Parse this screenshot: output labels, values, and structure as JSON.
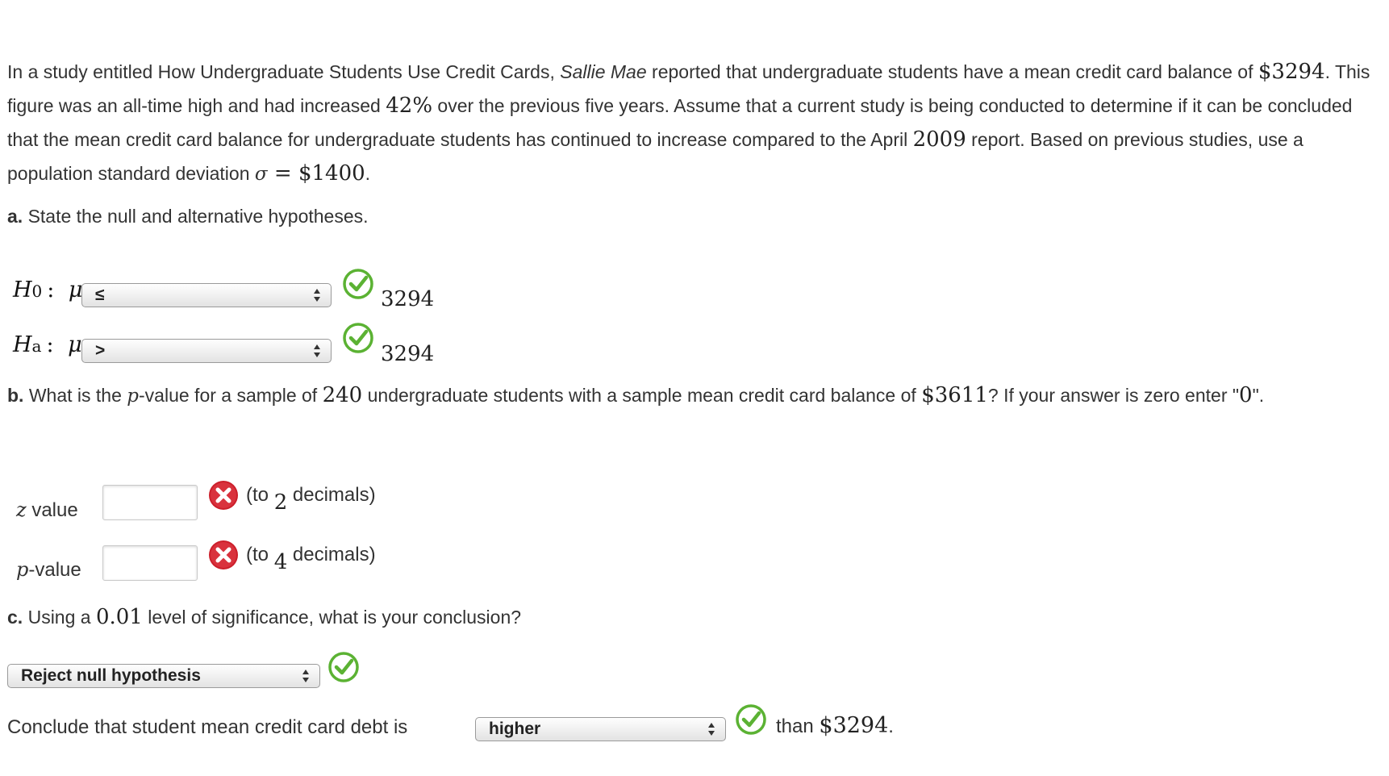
{
  "intro": {
    "t1": "In a study entitled How Undergraduate Students Use Credit Cards, ",
    "brand": "Sallie Mae",
    "t2": " reported that undergraduate students have a mean credit card balance of ",
    "balance": "$3294",
    "t3": ". This figure was an all-time high and had increased ",
    "pct": "42%",
    "t4": " over the previous five years. Assume that a current study is being conducted to determine if it can be concluded that the mean credit card balance for undergraduate students has continued to increase compared to the April ",
    "year": "2009",
    "t5": " report. Based on previous studies, use a population standard deviation ",
    "sigma": "σ",
    "eq": " = ",
    "sigma_val": "$1400",
    "t6": "."
  },
  "part_a": {
    "letter": "a.",
    "text": " State the null and alternative hypotheses.",
    "h0": {
      "H": "H",
      "sub": "0",
      "colon": ":",
      "mu": "μ",
      "selected": "≤",
      "value": "3294"
    },
    "ha": {
      "H": "H",
      "sub": "a",
      "colon": ":",
      "mu": "μ",
      "selected": ">",
      "value": "3294"
    }
  },
  "part_b": {
    "letter": "b.",
    "t1": " What is the ",
    "p": "p",
    "t2": "-value for a sample of ",
    "n": "240",
    "t3": " undergraduate students with a sample mean credit card balance of ",
    "xbar": "$3611",
    "t4": "? If your answer is zero enter \"",
    "zero": "0",
    "t5": "\".",
    "z_label_var": "z",
    "z_label_rest": " value",
    "z_value": "",
    "z_hint_a": "(to ",
    "z_hint_n": "2",
    "z_hint_b": " decimals)",
    "p_label_var": "p",
    "p_label_rest": "-value",
    "p_value": "",
    "p_hint_a": "(to ",
    "p_hint_n": "4",
    "p_hint_b": " decimals)"
  },
  "part_c": {
    "letter": "c.",
    "t1": " Using a ",
    "alpha": "0.01",
    "t2": " level of significance, what is your conclusion?",
    "decision": "Reject null hypothesis",
    "conclude_text": "Conclude that student mean credit card debt is",
    "direction": "higher",
    "than_text": "than ",
    "than_val": "$3294",
    "than_end": "."
  },
  "colors": {
    "correct_green": "#5bb233",
    "incorrect_red": "#cc1f2b",
    "text": "#333333"
  },
  "icons": {
    "correct": "check-circle-icon",
    "incorrect": "x-circle-icon",
    "select_arrows": "up-down-arrows-icon"
  }
}
